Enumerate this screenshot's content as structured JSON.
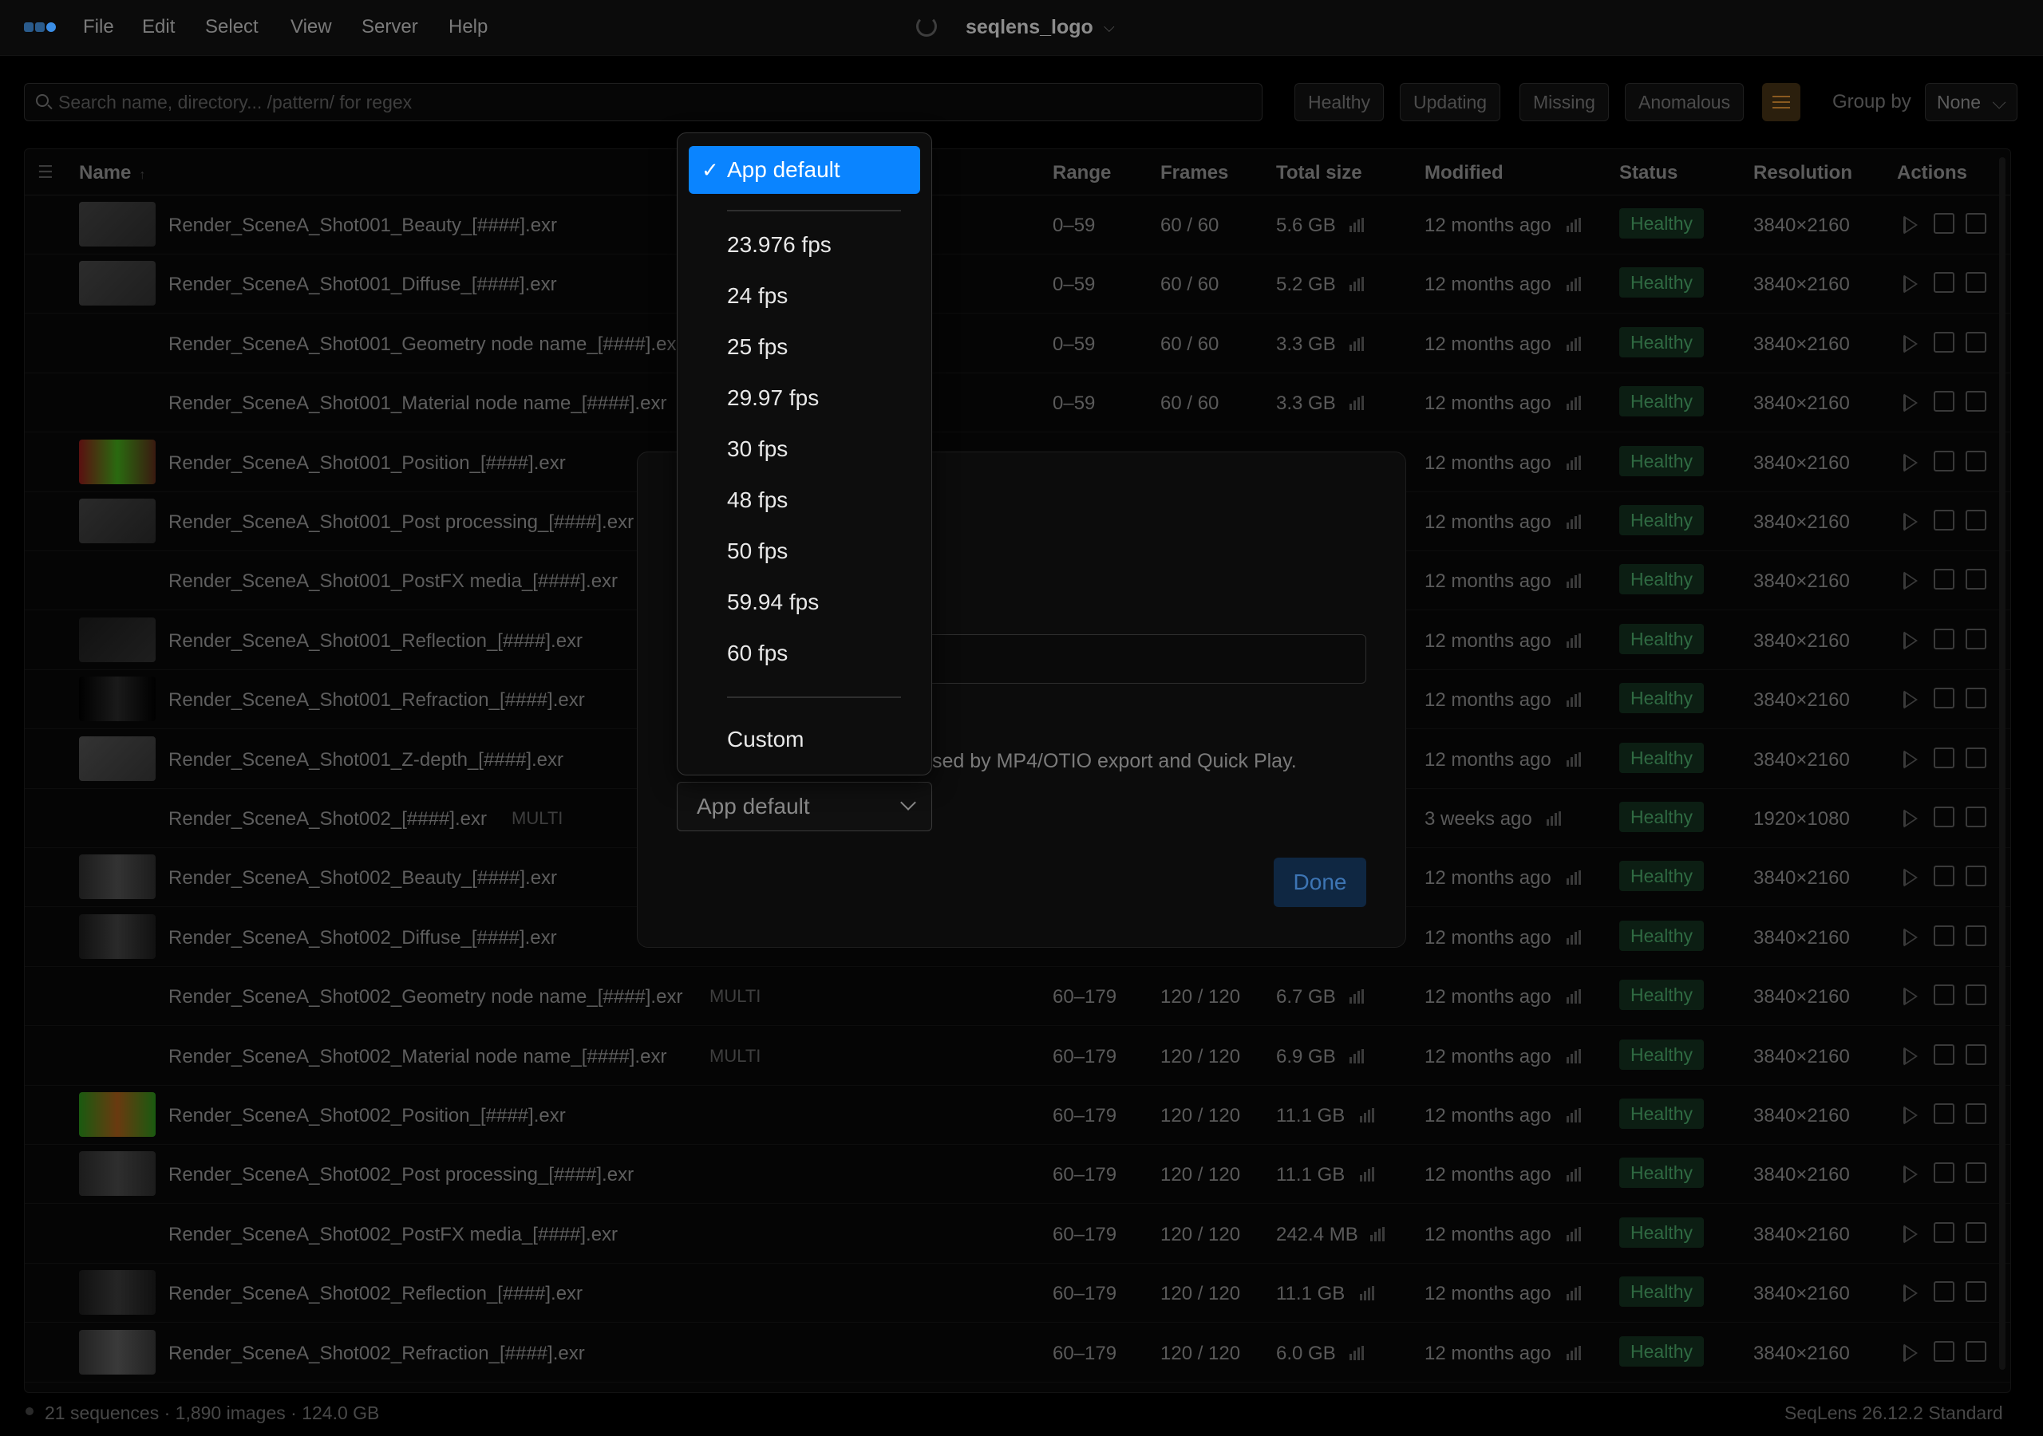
{
  "menubar": {
    "menus": [
      "File",
      "Edit",
      "Select",
      "View",
      "Server",
      "Help"
    ],
    "title": "seqlens_logo"
  },
  "toolbar": {
    "search_placeholder": "Search name, directory... /pattern/ for regex",
    "filters": [
      "Healthy",
      "Updating",
      "Missing",
      "Anomalous"
    ],
    "group_by_label": "Group by",
    "group_by_value": "None"
  },
  "table": {
    "columns": [
      "Name",
      "Range",
      "Frames",
      "Total size",
      "Modified",
      "Status",
      "Resolution",
      "Actions"
    ],
    "rows": [
      {
        "name": "Render_SceneA_Shot001_Beauty_[####].exr",
        "range": "0–59",
        "frames": "60 / 60",
        "size": "5.6 GB",
        "modified": "12 months ago",
        "status": "Healthy",
        "resolution": "3840×2160"
      },
      {
        "name": "Render_SceneA_Shot001_Diffuse_[####].exr",
        "range": "0–59",
        "frames": "60 / 60",
        "size": "5.2 GB",
        "modified": "12 months ago",
        "status": "Healthy",
        "resolution": "3840×2160"
      },
      {
        "name": "Render_SceneA_Shot001_Geometry node name_[####].exr",
        "range": "0–59",
        "frames": "60 / 60",
        "size": "3.3 GB",
        "modified": "12 months ago",
        "status": "Healthy",
        "resolution": "3840×2160"
      },
      {
        "name": "Render_SceneA_Shot001_Material node name_[####].exr",
        "range": "0–59",
        "frames": "60 / 60",
        "size": "3.3 GB",
        "modified": "12 months ago",
        "status": "Healthy",
        "resolution": "3840×2160"
      },
      {
        "name": "Render_SceneA_Shot001_Position_[####].exr",
        "range": "",
        "frames": "",
        "size": "",
        "modified": "12 months ago",
        "status": "Healthy",
        "resolution": "3840×2160"
      },
      {
        "name": "Render_SceneA_Shot001_Post processing_[####].exr",
        "range": "",
        "frames": "",
        "size": "",
        "modified": "12 months ago",
        "status": "Healthy",
        "resolution": "3840×2160"
      },
      {
        "name": "Render_SceneA_Shot001_PostFX media_[####].exr",
        "range": "",
        "frames": "",
        "size": "",
        "modified": "12 months ago",
        "status": "Healthy",
        "resolution": "3840×2160"
      },
      {
        "name": "Render_SceneA_Shot001_Reflection_[####].exr",
        "range": "",
        "frames": "",
        "size": "",
        "modified": "12 months ago",
        "status": "Healthy",
        "resolution": "3840×2160"
      },
      {
        "name": "Render_SceneA_Shot001_Refraction_[####].exr",
        "range": "",
        "frames": "",
        "size": "",
        "modified": "12 months ago",
        "status": "Healthy",
        "resolution": "3840×2160"
      },
      {
        "name": "Render_SceneA_Shot001_Z-depth_[####].exr",
        "range": "",
        "frames": "",
        "size": "",
        "modified": "12 months ago",
        "status": "Healthy",
        "resolution": "3840×2160"
      },
      {
        "name": "Render_SceneA_Shot002_[####].exr",
        "multi": "MULTI",
        "range": "",
        "frames": "",
        "size": "",
        "modified": "3 weeks ago",
        "status": "Healthy",
        "resolution": "1920×1080"
      },
      {
        "name": "Render_SceneA_Shot002_Beauty_[####].exr",
        "range": "",
        "frames": "",
        "size": "",
        "modified": "12 months ago",
        "status": "Healthy",
        "resolution": "3840×2160"
      },
      {
        "name": "Render_SceneA_Shot002_Diffuse_[####].exr",
        "range": "",
        "frames": "",
        "size": "",
        "modified": "12 months ago",
        "status": "Healthy",
        "resolution": "3840×2160"
      },
      {
        "name": "Render_SceneA_Shot002_Geometry node name_[####].exr",
        "multi": "MULTI",
        "range": "60–179",
        "frames": "120 / 120",
        "size": "6.7 GB",
        "modified": "12 months ago",
        "status": "Healthy",
        "resolution": "3840×2160"
      },
      {
        "name": "Render_SceneA_Shot002_Material node name_[####].exr",
        "multi": "MULTI",
        "range": "60–179",
        "frames": "120 / 120",
        "size": "6.9 GB",
        "modified": "12 months ago",
        "status": "Healthy",
        "resolution": "3840×2160"
      },
      {
        "name": "Render_SceneA_Shot002_Position_[####].exr",
        "range": "60–179",
        "frames": "120 / 120",
        "size": "11.1 GB",
        "modified": "12 months ago",
        "status": "Healthy",
        "resolution": "3840×2160"
      },
      {
        "name": "Render_SceneA_Shot002_Post processing_[####].exr",
        "range": "60–179",
        "frames": "120 / 120",
        "size": "11.1 GB",
        "modified": "12 months ago",
        "status": "Healthy",
        "resolution": "3840×2160"
      },
      {
        "name": "Render_SceneA_Shot002_PostFX media_[####].exr",
        "range": "60–179",
        "frames": "120 / 120",
        "size": "242.4 MB",
        "modified": "12 months ago",
        "status": "Healthy",
        "resolution": "3840×2160"
      },
      {
        "name": "Render_SceneA_Shot002_Reflection_[####].exr",
        "range": "60–179",
        "frames": "120 / 120",
        "size": "11.1 GB",
        "modified": "12 months ago",
        "status": "Healthy",
        "resolution": "3840×2160"
      },
      {
        "name": "Render_SceneA_Shot002_Refraction_[####].exr",
        "range": "60–179",
        "frames": "120 / 120",
        "size": "6.0 GB",
        "modified": "12 months ago",
        "status": "Healthy",
        "resolution": "3840×2160"
      }
    ]
  },
  "statusbar": {
    "summary": "21 sequences · 1,890 images · 124.0 GB",
    "version": "SeqLens 26.12.2 Standard"
  },
  "dialog": {
    "description": "sed by MP4/OTIO export and Quick Play.",
    "fps_selected": "App default",
    "done_label": "Done"
  },
  "dropdown": {
    "check": "✓",
    "default": "App default",
    "rates": [
      "23.976 fps",
      "24 fps",
      "25 fps",
      "29.97 fps",
      "30 fps",
      "48 fps",
      "50 fps",
      "59.94 fps",
      "60 fps"
    ],
    "custom": "Custom"
  },
  "colors": {
    "accent": "#0a84ff",
    "healthy_text": "#2f6a42",
    "healthy_bg": "#0c1e13"
  }
}
